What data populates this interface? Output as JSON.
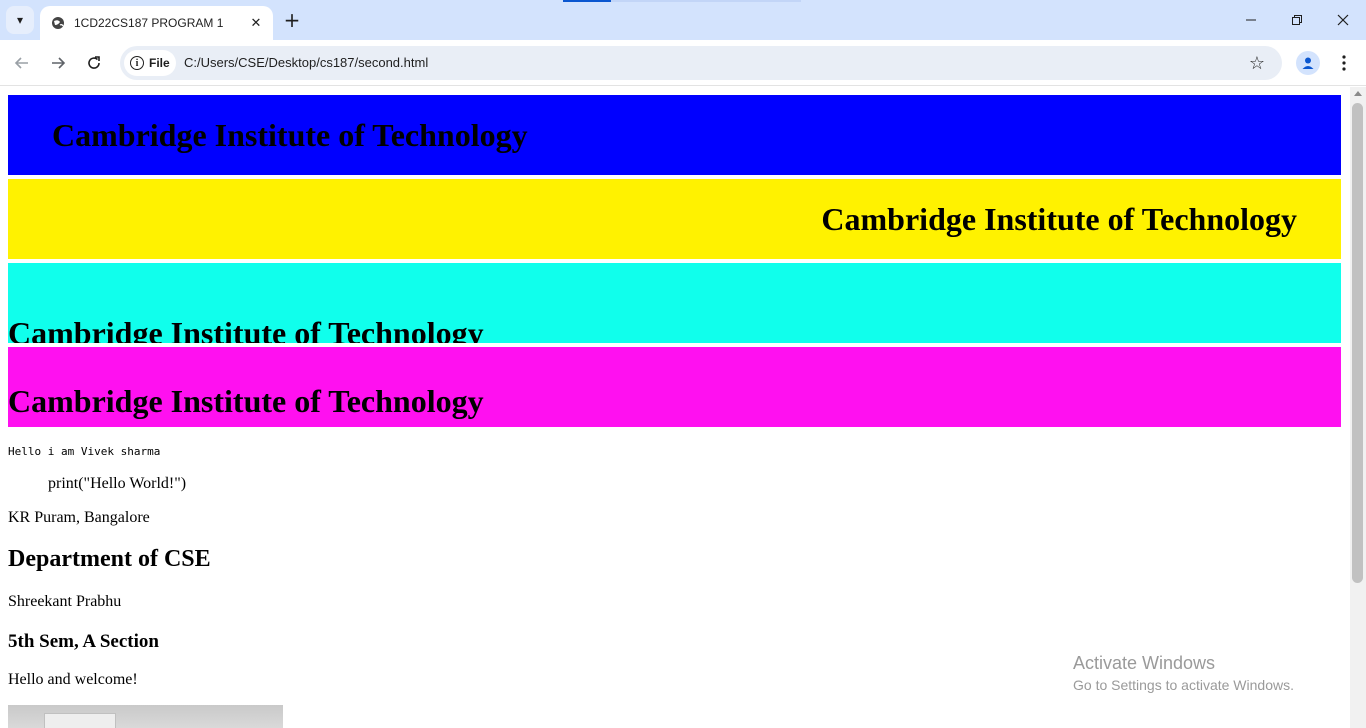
{
  "browser": {
    "tab_title": "1CD22CS187 PROGRAM 1",
    "new_tab_symbol": "+",
    "close_tab_symbol": "✕",
    "security_chip_label": "File",
    "url": "C:/Users/CSE/Desktop/cs187/second.html",
    "icons": [
      "tab-search-icon",
      "globe-icon",
      "close-icon",
      "plus-icon",
      "minimize-icon",
      "restore-icon",
      "close-window-icon",
      "back-arrow-icon",
      "forward-arrow-icon",
      "reload-icon",
      "info-icon",
      "star-icon",
      "profile-icon",
      "kebab-menu-icon"
    ]
  },
  "page": {
    "headings": [
      "Cambridge Institute of Technology",
      "Cambridge Institute of Technology",
      "Cambridge Institute of Technology",
      "Cambridge Institute of Technology"
    ],
    "band_colors": [
      "#0000ff",
      "#fff200",
      "#10ffec",
      "#ff10f0"
    ],
    "mono_text": "Hello i am Vivek sharma",
    "code_text": "print(\"Hello World!\")",
    "address": "KR Puram, Bangalore",
    "department": "Department of CSE",
    "person": "Shreekant Prabhu",
    "semester": "5th Sem, A Section",
    "greeting": "Hello and welcome!"
  },
  "watermark": {
    "title": "Activate Windows",
    "subtitle": "Go to Settings to activate Windows."
  }
}
